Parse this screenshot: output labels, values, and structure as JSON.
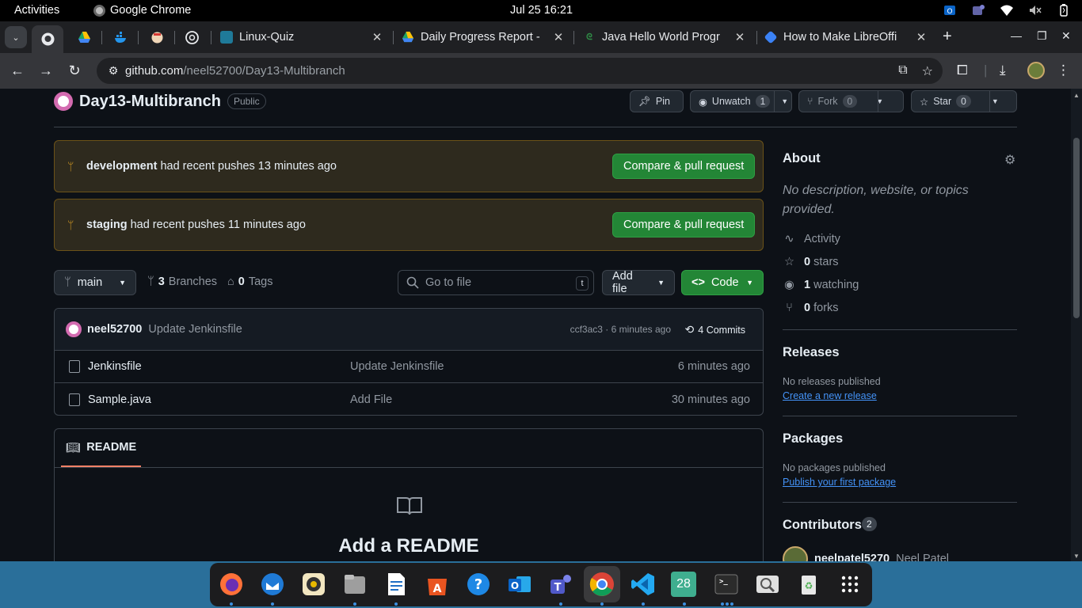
{
  "topbar": {
    "activities": "Activities",
    "app_name": "Google Chrome",
    "clock": "Jul 25  16:21"
  },
  "tabs": [
    {
      "title": "Linux-Quiz",
      "icon_color": "#1f7a99"
    },
    {
      "title": "Daily Progress Report - ",
      "icon_color": "#e9b000"
    },
    {
      "title": "Java Hello World Progr",
      "icon_color": "#2f8d46"
    },
    {
      "title": "How to Make LibreOffi",
      "icon_color": "#3b82f6"
    }
  ],
  "omnibox": {
    "host": "github.com",
    "path": "/neel52700/Day13-Multibranch"
  },
  "repo": {
    "name": "Day13-Multibranch",
    "visibility": "Public",
    "pin_label": "Pin",
    "unwatch_label": "Unwatch",
    "watch_count": "1",
    "fork_label": "Fork",
    "fork_count": "0",
    "star_label": "Star",
    "star_count": "0"
  },
  "banners": [
    {
      "branch": "development",
      "text": " had recent pushes 13 minutes ago",
      "button": "Compare & pull request"
    },
    {
      "branch": "staging",
      "text": " had recent pushes 11 minutes ago",
      "button": "Compare & pull request"
    }
  ],
  "nav": {
    "branch": "main",
    "branches_count": "3",
    "branches_label": "Branches",
    "tags_count": "0",
    "tags_label": "Tags",
    "goto_placeholder": "Go to file",
    "goto_key": "t",
    "add_file": "Add file",
    "code": "Code"
  },
  "commit": {
    "author": "neel52700",
    "message": "Update Jenkinsfile",
    "sha_time": "ccf3ac3 · 6 minutes ago",
    "commits": "4 Commits"
  },
  "files": [
    {
      "name": "Jenkinsfile",
      "message": "Update Jenkinsfile",
      "time": "6 minutes ago"
    },
    {
      "name": "Sample.java",
      "message": "Add File",
      "time": "30 minutes ago"
    }
  ],
  "readme": {
    "tab": "README",
    "title": "Add a README"
  },
  "about": {
    "heading": "About",
    "description": "No description, website, or topics provided.",
    "activity": "Activity",
    "stars_count": "0",
    "stars_label": "stars",
    "watching_count": "1",
    "watching_label": "watching",
    "forks_count": "0",
    "forks_label": "forks"
  },
  "releases": {
    "heading": "Releases",
    "empty": "No releases published",
    "link": "Create a new release"
  },
  "packages": {
    "heading": "Packages",
    "empty": "No packages published",
    "link": "Publish your first package"
  },
  "contributors": {
    "heading": "Contributors",
    "count": "2",
    "first_user": "neelpatel5270",
    "first_name": "Neel Patel"
  },
  "dock": {
    "calendar_day": "28"
  },
  "colors": {
    "accent_green": "#238636",
    "link_blue": "#4493f8",
    "banner_bg": "#2e2a1e"
  }
}
